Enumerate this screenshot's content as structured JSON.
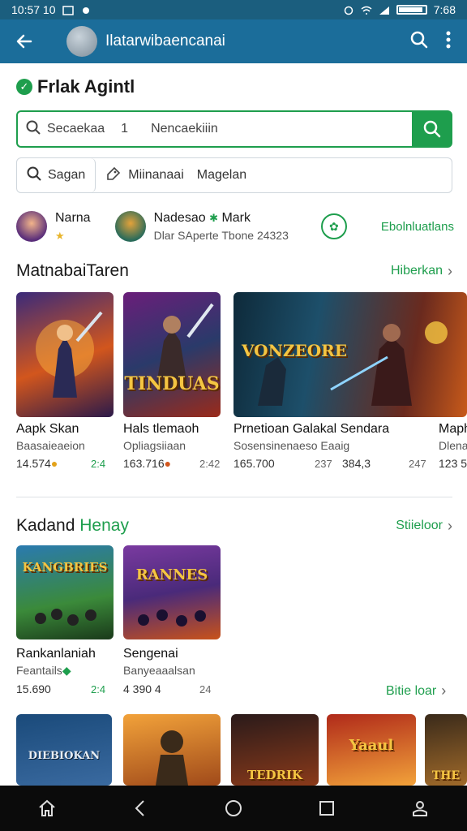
{
  "status_bar": {
    "time_left": "10:57 10",
    "time_right": "7:68"
  },
  "app_bar": {
    "title": "Ilatarwibaencanai"
  },
  "heading": "Frlak Agintl",
  "search": {
    "placeholder": "Secaekaa",
    "separator": "1",
    "secondary_text": "Nencaekiiin"
  },
  "filters": {
    "chip1": "Sagan",
    "chip2": "Miinanaai",
    "chip3": "Magelan"
  },
  "people": [
    {
      "name": "Narna",
      "sub": ""
    },
    {
      "name": "Nadesao",
      "name_suffix": "Mark",
      "sub": "Dlar SAperte Tbone 24323"
    }
  ],
  "people_link": "Ebolnluatlans",
  "section1": {
    "title": "MatnabaiTaren",
    "more": "Hiberkan",
    "items": [
      {
        "name": "Aapk Skan",
        "sub": "Baasaieaeion",
        "stat1": "14.574",
        "stat2": "2:4"
      },
      {
        "name": "Hals tlemaoh",
        "sub": "Opliagsiiaan",
        "stat1": "163.716",
        "stat2": "2:42",
        "art": "TINDUAS"
      },
      {
        "name": "Prnetioan Galakal Sendara",
        "sub": "Sosensinenaeso Eaaig",
        "stat1": "165.700",
        "stat2": "237",
        "stat3": "384,3",
        "stat4": "247",
        "art": "VONZEORE"
      },
      {
        "name": "Maph",
        "sub": "Dlena",
        "stat1": "123 5"
      }
    ]
  },
  "section2": {
    "title_part1": "Kadand",
    "title_part2": "Henay",
    "more": "Stiieloor",
    "more2": "Bitie loar",
    "items": [
      {
        "name": "Rankanlaniah",
        "sub": "Feantails",
        "stat1": "15.690",
        "stat2": "2:4",
        "art": "KANGBRIES"
      },
      {
        "name": "Sengenai",
        "sub": "Banyeaaalsan",
        "stat1": "4 390 4",
        "stat2": "24",
        "art": "RANNES"
      }
    ]
  },
  "row3": [
    {
      "art": "DIEBIOKAN"
    },
    {
      "art": ""
    },
    {
      "art": "TEDRIK"
    },
    {
      "art": "Yaaul"
    },
    {
      "art": "THE"
    }
  ],
  "colors": {
    "accent": "#1e9e4d",
    "app_bar": "#1b6d9a",
    "status_bar": "#1b5e7e"
  }
}
